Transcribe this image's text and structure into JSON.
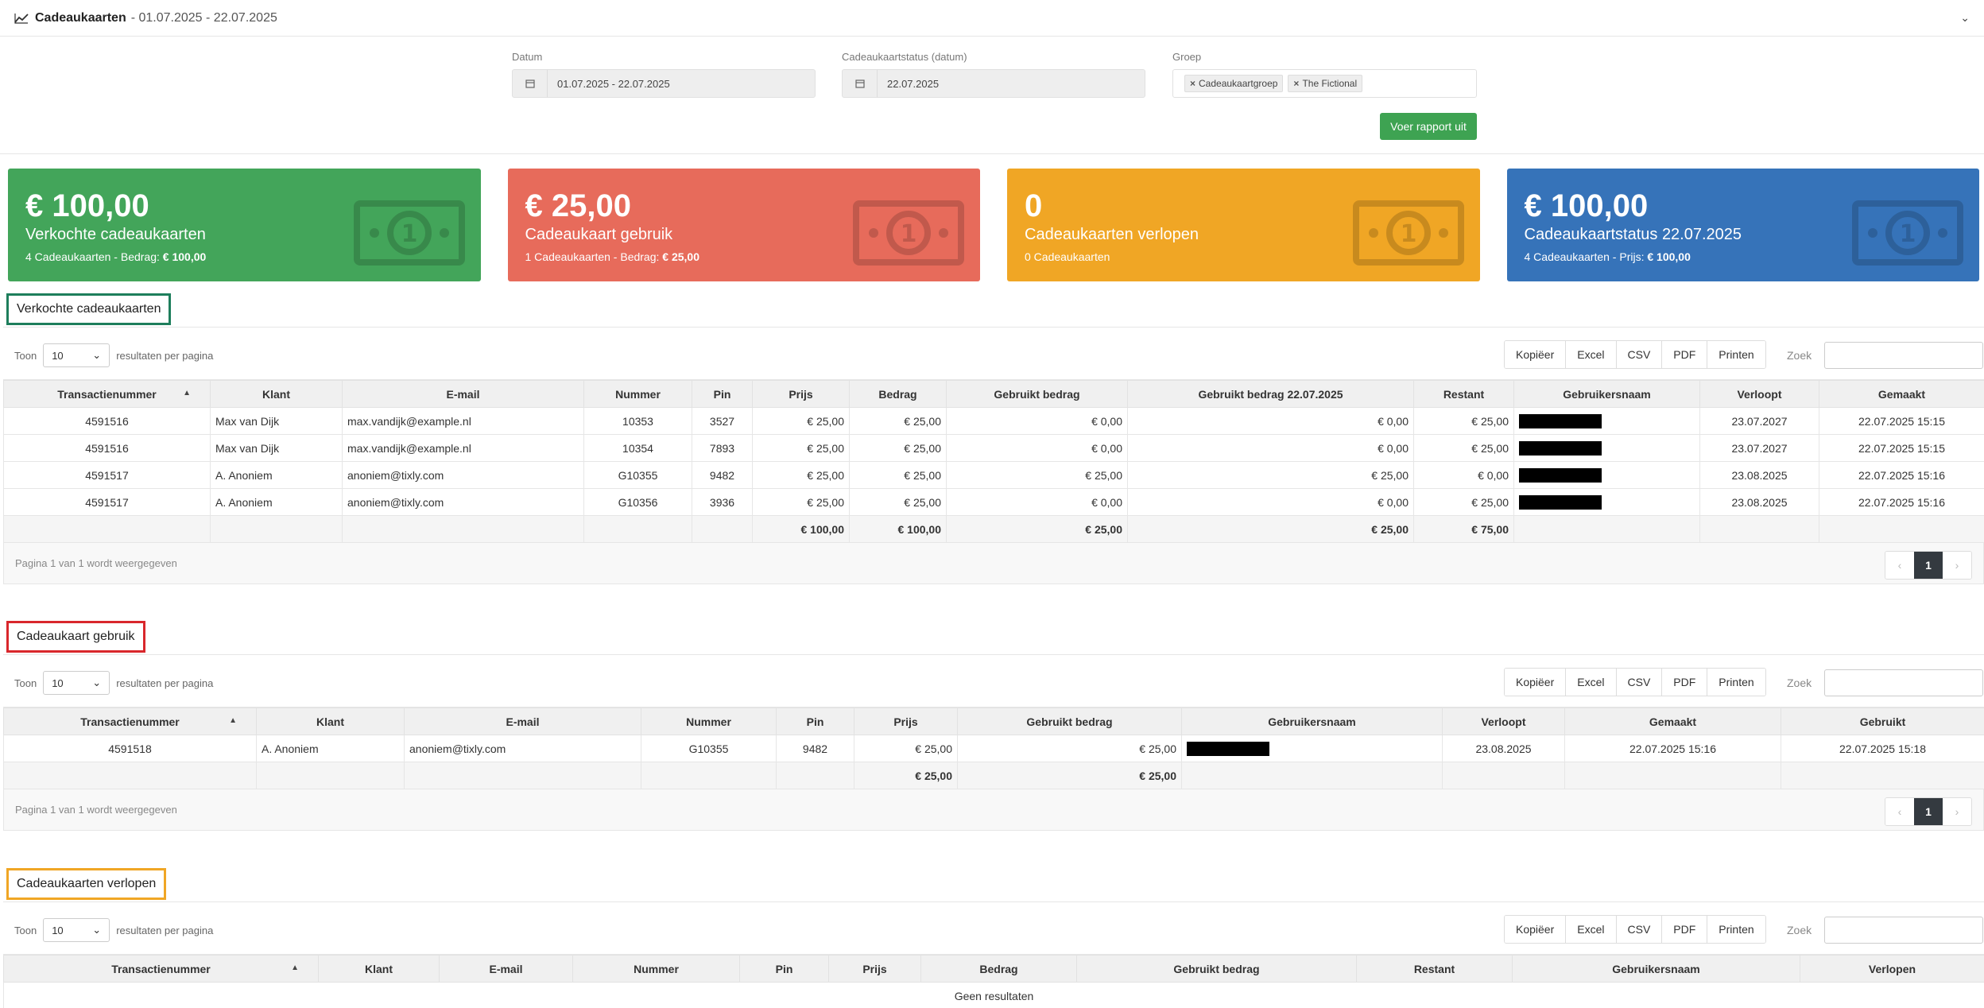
{
  "header": {
    "title": "Cadeaukaarten",
    "range": "- 01.07.2025 - 22.07.2025"
  },
  "filters": {
    "date": {
      "label": "Datum",
      "value": "01.07.2025 - 22.07.2025"
    },
    "status": {
      "label": "Cadeaukaartstatus (datum)",
      "value": "22.07.2025"
    },
    "group": {
      "label": "Groep",
      "tags": [
        "Cadeaukaartgroep",
        "The Fictional"
      ]
    },
    "run_label": "Voer rapport uit"
  },
  "cards": [
    {
      "amount": "€ 100,00",
      "label": "Verkochte cadeaukaarten",
      "sub": "4 Cadeaukaarten - Bedrag: ",
      "sub_bold": "€ 100,00",
      "color": "#43a55a"
    },
    {
      "amount": "€ 25,00",
      "label": "Cadeaukaart gebruik",
      "sub": "1 Cadeaukaarten - Bedrag: ",
      "sub_bold": "€ 25,00",
      "color": "#e76b5b"
    },
    {
      "amount": "0",
      "label": "Cadeaukaarten verlopen",
      "sub": "0 Cadeaukaarten",
      "sub_bold": "",
      "color": "#f0a625"
    },
    {
      "amount": "€ 100,00",
      "label": "Cadeaukaartstatus 22.07.2025",
      "sub": "4 Cadeaukaarten - Prijs: ",
      "sub_bold": "€ 100,00",
      "color": "#3673b9"
    }
  ],
  "common": {
    "show": "Toon",
    "per_page": "10",
    "per_page_suffix": "resultaten per pagina",
    "buttons": [
      "Kopiëer",
      "Excel",
      "CSV",
      "PDF",
      "Printen"
    ],
    "search": "Zoek",
    "page_info": "Pagina 1 van 1 wordt weergegeven",
    "page": "1",
    "prev": "‹",
    "next": "›"
  },
  "sold": {
    "title": "Verkochte cadeaukaarten",
    "columns": [
      "Transactienummer",
      "Klant",
      "E-mail",
      "Nummer",
      "Pin",
      "Prijs",
      "Bedrag",
      "Gebruikt bedrag",
      "Gebruikt bedrag 22.07.2025",
      "Restant",
      "Gebruikersnaam",
      "Verloopt",
      "Gemaakt"
    ],
    "rows": [
      [
        "4591516",
        "Max van Dijk",
        "max.vandijk@example.nl",
        "10353",
        "3527",
        "€ 25,00",
        "€ 25,00",
        "€ 0,00",
        "€ 0,00",
        "€ 25,00",
        "",
        "23.07.2027",
        "22.07.2025 15:15"
      ],
      [
        "4591516",
        "Max van Dijk",
        "max.vandijk@example.nl",
        "10354",
        "7893",
        "€ 25,00",
        "€ 25,00",
        "€ 0,00",
        "€ 0,00",
        "€ 25,00",
        "",
        "23.07.2027",
        "22.07.2025 15:15"
      ],
      [
        "4591517",
        "A. Anoniem",
        "anoniem@tixly.com",
        "G10355",
        "9482",
        "€ 25,00",
        "€ 25,00",
        "€ 25,00",
        "€ 25,00",
        "€ 0,00",
        "",
        "23.08.2025",
        "22.07.2025 15:16"
      ],
      [
        "4591517",
        "A. Anoniem",
        "anoniem@tixly.com",
        "G10356",
        "3936",
        "€ 25,00",
        "€ 25,00",
        "€ 0,00",
        "€ 0,00",
        "€ 25,00",
        "",
        "23.08.2025",
        "22.07.2025 15:16"
      ]
    ],
    "totals": [
      "",
      "",
      "",
      "",
      "",
      "€ 100,00",
      "€ 100,00",
      "€ 25,00",
      "€ 25,00",
      "€ 75,00",
      "",
      "",
      ""
    ]
  },
  "usage": {
    "title": "Cadeaukaart gebruik",
    "columns": [
      "Transactienummer",
      "Klant",
      "E-mail",
      "Nummer",
      "Pin",
      "Prijs",
      "Gebruikt bedrag",
      "Gebruikersnaam",
      "Verloopt",
      "Gemaakt",
      "Gebruikt"
    ],
    "rows": [
      [
        "4591518",
        "A. Anoniem",
        "anoniem@tixly.com",
        "G10355",
        "9482",
        "€ 25,00",
        "€ 25,00",
        "",
        "23.08.2025",
        "22.07.2025 15:16",
        "22.07.2025 15:18"
      ]
    ],
    "totals": [
      "",
      "",
      "",
      "",
      "",
      "€ 25,00",
      "€ 25,00",
      "",
      "",
      "",
      ""
    ]
  },
  "expired": {
    "title": "Cadeaukaarten verlopen",
    "columns": [
      "Transactienummer",
      "Klant",
      "E-mail",
      "Nummer",
      "Pin",
      "Prijs",
      "Bedrag",
      "Gebruikt bedrag",
      "Restant",
      "Gebruikersnaam",
      "Verlopen"
    ],
    "empty": "Geen resultaten"
  }
}
